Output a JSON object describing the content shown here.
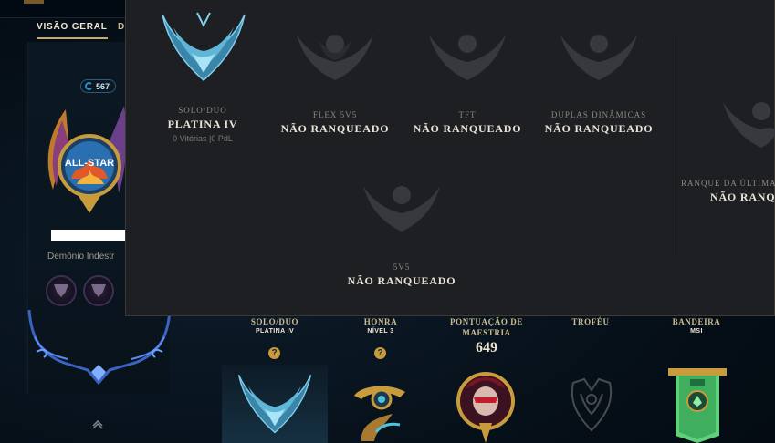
{
  "tabs": [
    {
      "label": "VISÃO GERAL",
      "active": true
    },
    {
      "label": "D",
      "active": false
    }
  ],
  "profile": {
    "level": "567",
    "crest_text": "ALL-STAR",
    "title": "Demônio Indestr"
  },
  "popup": {
    "queues": [
      {
        "label": "SOLO/DUO",
        "tier": "PLATINA IV",
        "stats": "0 Vitórias |0 PdL",
        "ranked": true
      },
      {
        "label": "FLEX 5V5",
        "tier": "NÃO RANQUEADO",
        "ranked": false
      },
      {
        "label": "TFT",
        "tier": "NÃO RANQUEADO",
        "ranked": false
      },
      {
        "label": "DUPLAS DINÂMICAS",
        "tier": "NÃO RANQUEADO",
        "ranked": false
      },
      {
        "label": "RANQUE DA ÚLTIMA",
        "tier": "NÃO RANQU",
        "ranked": false
      },
      {
        "label": "5V5",
        "tier": "NÃO RANQUEADO",
        "ranked": false
      }
    ]
  },
  "stats": [
    {
      "label": "SOLO/DUO",
      "sub": "PLATINA IV",
      "icon": "question-icon"
    },
    {
      "label": "HONRA",
      "sub": "NÍVEL 3",
      "icon": "question-icon"
    },
    {
      "label": "PONTUAÇÃO DE",
      "label2": "MAESTRIA",
      "value": "649"
    },
    {
      "label": "TROFÉU",
      "sub": ""
    },
    {
      "label": "BANDEIRA",
      "sub": "MSI"
    }
  ],
  "colors": {
    "gold": "#c8aa6e",
    "panel": "#1e1f22",
    "platinum": "#4fa8c7",
    "unranked": "#3a3b3f"
  }
}
